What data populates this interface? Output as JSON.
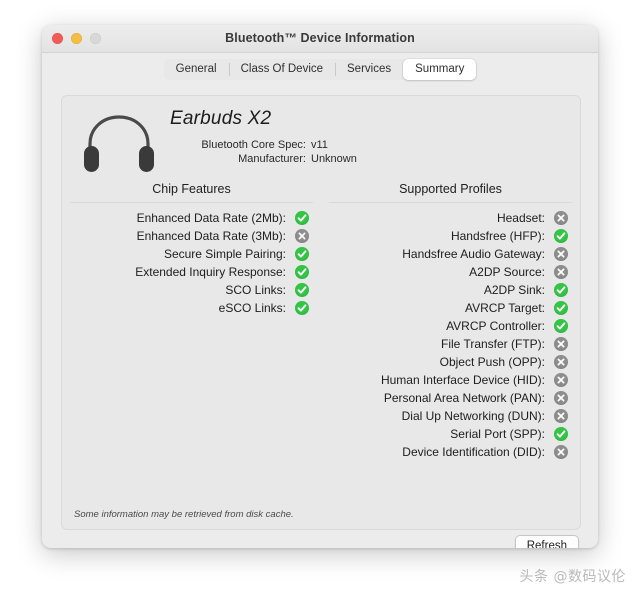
{
  "window": {
    "title": "Bluetooth™ Device Information",
    "traffic_lights": [
      "close",
      "minimize",
      "zoom"
    ]
  },
  "tabs": [
    {
      "label": "General",
      "selected": false
    },
    {
      "label": "Class Of Device",
      "selected": false
    },
    {
      "label": "Services",
      "selected": false
    },
    {
      "label": "Summary",
      "selected": true
    }
  ],
  "device": {
    "icon": "headphones-icon",
    "name": "Earbuds X2",
    "specs": [
      {
        "label": "Bluetooth Core Spec:",
        "value": "v11"
      },
      {
        "label": "Manufacturer:",
        "value": "Unknown"
      }
    ]
  },
  "chip_features": {
    "title": "Chip Features",
    "rows": [
      {
        "label": "Enhanced Data Rate (2Mb):",
        "status": "yes"
      },
      {
        "label": "Enhanced Data Rate (3Mb):",
        "status": "no"
      },
      {
        "label": "Secure Simple Pairing:",
        "status": "yes"
      },
      {
        "label": "Extended Inquiry Response:",
        "status": "yes"
      },
      {
        "label": "SCO Links:",
        "status": "yes"
      },
      {
        "label": "eSCO Links:",
        "status": "yes"
      }
    ]
  },
  "supported_profiles": {
    "title": "Supported Profiles",
    "rows": [
      {
        "label": "Headset:",
        "status": "no"
      },
      {
        "label": "Handsfree (HFP):",
        "status": "yes"
      },
      {
        "label": "Handsfree Audio Gateway:",
        "status": "no"
      },
      {
        "label": "A2DP Source:",
        "status": "no"
      },
      {
        "label": "A2DP Sink:",
        "status": "yes"
      },
      {
        "label": "AVRCP Target:",
        "status": "yes"
      },
      {
        "label": "AVRCP Controller:",
        "status": "yes"
      },
      {
        "label": "File Transfer (FTP):",
        "status": "no"
      },
      {
        "label": "Object Push (OPP):",
        "status": "no"
      },
      {
        "label": "Human Interface Device (HID):",
        "status": "no"
      },
      {
        "label": "Personal Area Network (PAN):",
        "status": "no"
      },
      {
        "label": "Dial Up Networking (DUN):",
        "status": "no"
      },
      {
        "label": "Serial Port (SPP):",
        "status": "yes"
      },
      {
        "label": "Device Identification (DID):",
        "status": "no"
      }
    ]
  },
  "footer": {
    "note": "Some information may be retrieved from disk cache.",
    "refresh_label": "Refresh"
  },
  "watermark": {
    "text": "头条 @数码议伦"
  },
  "colors": {
    "status_yes": "#34c546",
    "status_no": "#8e8e8e",
    "window_bg": "#ececec",
    "panel_bg": "#e8e8e8",
    "traffic_red": "#f25b56",
    "traffic_yellow": "#f6bd42",
    "traffic_gray": "#d8d8d8"
  }
}
